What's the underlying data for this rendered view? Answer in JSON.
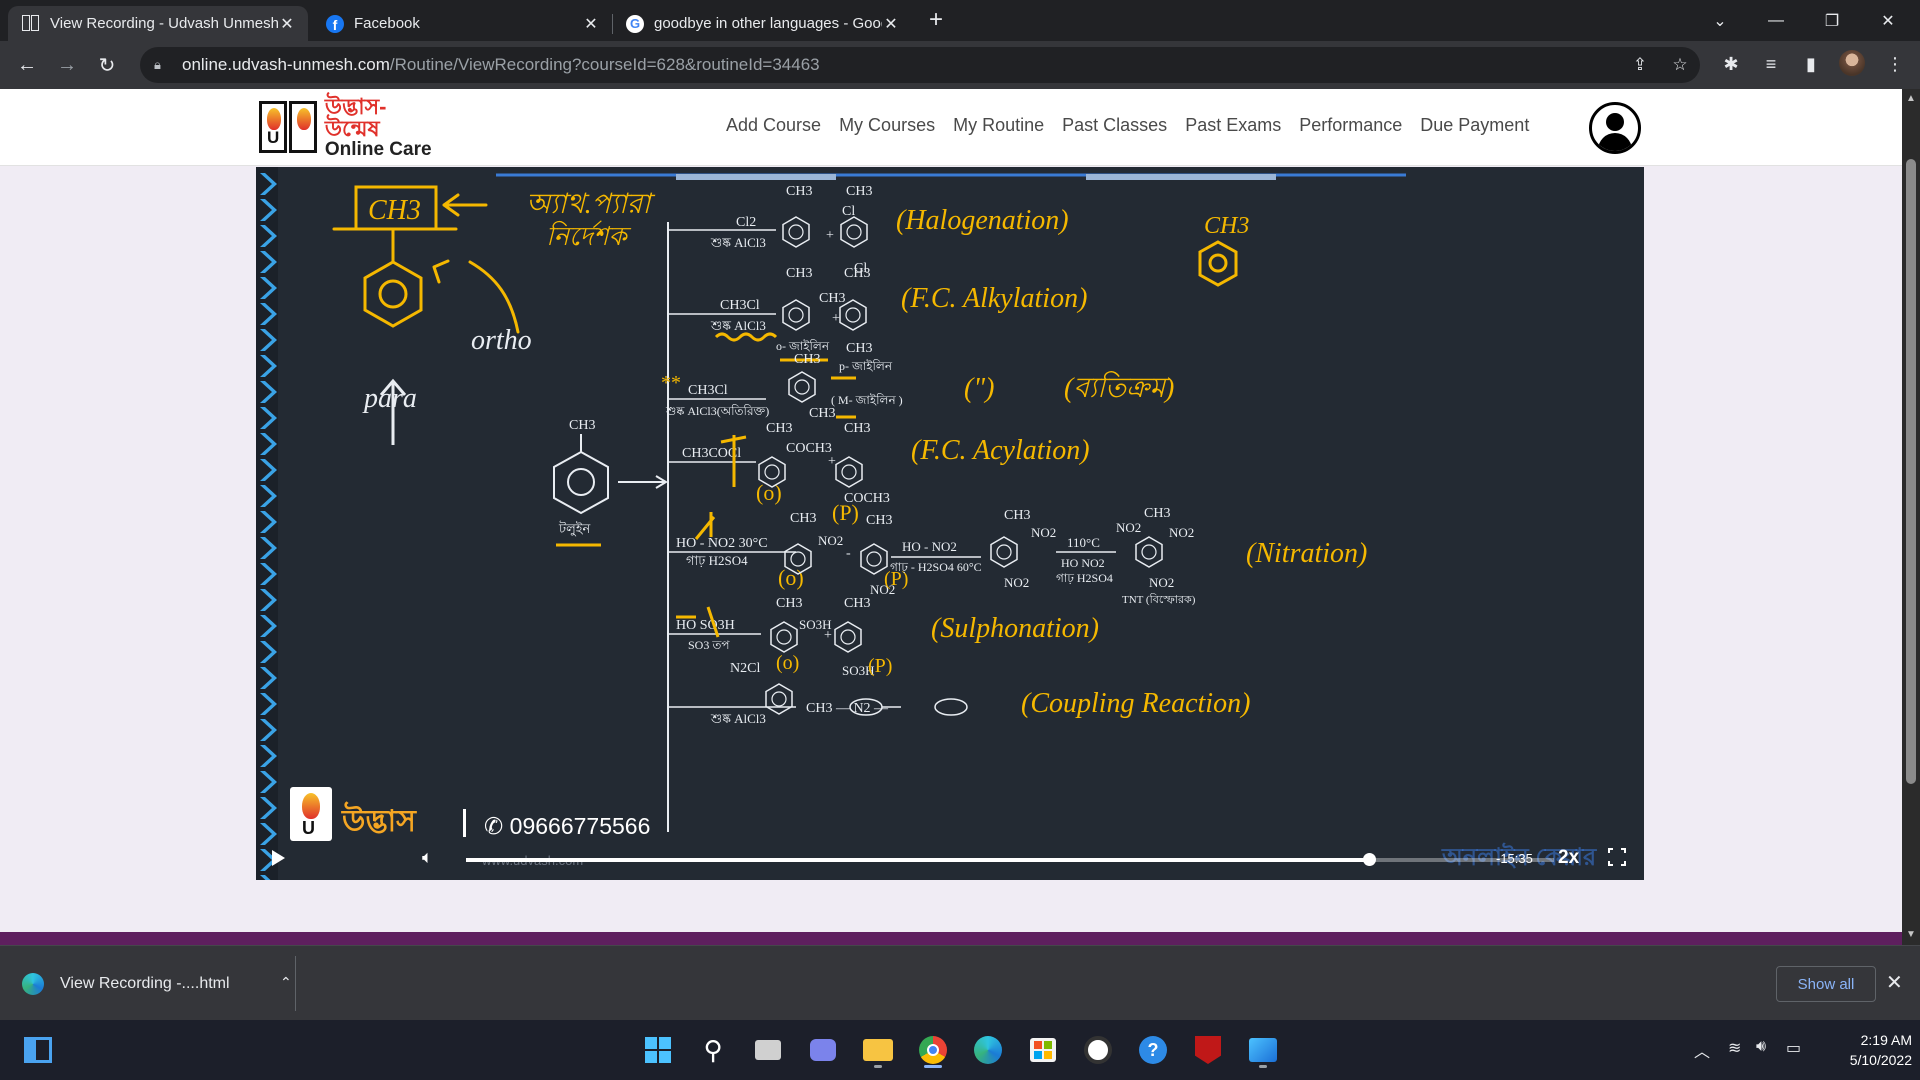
{
  "browser": {
    "tabs": [
      {
        "title": "View Recording - Udvash Unmesh",
        "active": true,
        "icon": "udvash-favicon"
      },
      {
        "title": "Facebook",
        "active": false,
        "icon": "facebook-icon"
      },
      {
        "title": "goodbye in other languages - Google Search",
        "active": false,
        "icon": "google-icon"
      }
    ],
    "url_host": "online.udvash-unmesh.com",
    "url_path": "/Routine/ViewRecording?courseId=628&routineId=34463"
  },
  "site": {
    "logo_bn": "উদ্ভাস-উন্মেষ",
    "logo_en": "Online Care",
    "nav": [
      "Add Course",
      "My Courses",
      "My Routine",
      "Past Classes",
      "Past Exams",
      "Performance",
      "Due Payment"
    ]
  },
  "video": {
    "board": {
      "left": {
        "ch3_box": "CH3",
        "bn_note1": "অ্যাথ.প্যারা",
        "bn_note2": "নির্দেশক",
        "ortho": "ortho",
        "para": "para",
        "toluene_ch3": "CH3",
        "toluene_bn": "টলুইন"
      },
      "reactions": [
        {
          "reagent_top": "Cl2",
          "reagent_bottom": "শুষ্ক AlCl3",
          "product1_sub": "CH3",
          "product1_side": "Cl",
          "product2_top": "CH3",
          "product2_bottom": "Cl",
          "label": "(Halogenation)"
        },
        {
          "reagent_top": "CH3Cl",
          "reagent_bottom": "শুষ্ক AlCl3",
          "product1_sub": "CH3",
          "product1_side": "CH3",
          "product1_name": "o- জাইলিন",
          "product2_top": "CH3",
          "product2_bottom": "CH3",
          "product2_name": "p- জাইলিন",
          "label": "(F.C. Alkylation)"
        },
        {
          "reagent_top": "CH3Cl",
          "reagent_bottom": "শুষ্ক AlCl3(অতিরিক্ত)",
          "product1_sub": "CH3",
          "product1_side": "CH3",
          "product1_name": "( M- জাইলিন )",
          "label": "(\")",
          "label2": "(ব্যতিক্রম)"
        },
        {
          "reagent_top": "CH3COCl",
          "product1_sub": "CH3",
          "product1_side": "COCH3",
          "product1_tag": "(o)",
          "product2_top": "CH3",
          "product2_bottom": "COCH3",
          "product2_tag": "(P)",
          "label": "(F.C. Acylation)"
        },
        {
          "reagent_top": "HO - NO2 30°C",
          "reagent_bottom": "গাঢ় H2SO4",
          "product1_sub": "CH3",
          "product1_side": "NO2",
          "product1_tag": "(o)",
          "product2_top": "CH3",
          "product2_bottom": "NO2",
          "product2_tag": "(P)",
          "step2_top": "HO - NO2",
          "step2_bottom": "গাঢ় - H2SO4 60°C",
          "product3_top": "CH3",
          "product3_side": "NO2",
          "product3_bottom": "NO2",
          "step3_top": "110°C",
          "step3_mid": "HO NO2",
          "step3_bottom": "গাঢ় H2SO4",
          "product4_top": "CH3",
          "product4_left": "NO2",
          "product4_right": "NO2",
          "product4_bottom": "NO2",
          "product4_name": "TNT (বিস্ফোরক)",
          "label": "(Nitration)"
        },
        {
          "reagent_top": "HO SO3H",
          "reagent_bottom": "SO3 তপ",
          "product1_sub": "CH3",
          "product1_side": "SO3H",
          "product1_tag": "(o)",
          "product2_top": "CH3",
          "product2_bottom": "SO3H",
          "product2_tag": "(P)",
          "label": "(Sulphonation)"
        },
        {
          "reagent_top": "N2Cl",
          "reagent_bottom": "শুষ্ক AlCl3",
          "product": "CH3 — N2 —",
          "label": "(Coupling Reaction)"
        }
      ],
      "corner_ch3": "CH3"
    },
    "overlay_brand": "উদ্ভাস",
    "phone": "09666775566",
    "website": "www.udvash.com",
    "watermark": "অনলাইন কেয়ার",
    "time_remaining": "-15:35",
    "speed": "2x",
    "progress": 0.83
  },
  "downloads": {
    "file": "View Recording -....html",
    "show_all": "Show all"
  },
  "system": {
    "time": "2:19 AM",
    "date": "5/10/2022"
  },
  "colors": {
    "board_bg": "#232a33",
    "ink_yellow": "#f5b800",
    "chalk_white": "#e9edf2",
    "accent_blue": "#3a7bd5",
    "footer_purple": "#5e1f5e"
  }
}
